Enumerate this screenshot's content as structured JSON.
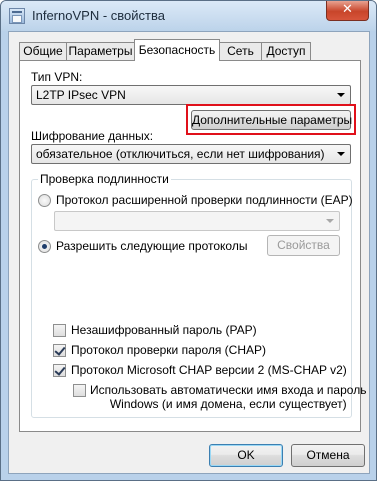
{
  "window": {
    "title": "InfernoVPN - свойства",
    "close_glyph": "✕"
  },
  "tabs": [
    {
      "label": "Общие",
      "active": false
    },
    {
      "label": "Параметры",
      "active": false
    },
    {
      "label": "Безопасность",
      "active": true
    },
    {
      "label": "Сеть",
      "active": false
    },
    {
      "label": "Доступ",
      "active": false
    }
  ],
  "security": {
    "vpn_type_label": "Тип VPN:",
    "vpn_type_value": "L2TP IPsec VPN",
    "advanced_button": "Дополнительные параметры",
    "encryption_label": "Шифрование данных:",
    "encryption_value": "обязательное (отключиться, если нет шифрования)",
    "auth_group_title": "Проверка подлинности",
    "eap_option": "Протокол расширенной проверки подлинности (EAP)",
    "eap_selected": false,
    "eap_combo_value": "",
    "allow_protocols_option": "Разрешить следующие протоколы",
    "allow_protocols_selected": true,
    "properties_button": "Свойства",
    "protocols": [
      {
        "label": "Незашифрованный пароль (PAP)",
        "checked": false
      },
      {
        "label": "Протокол проверки пароля (CHAP)",
        "checked": true
      },
      {
        "label": "Протокол Microsoft CHAP версии 2 (MS-CHAP v2)",
        "checked": true
      }
    ],
    "auto_logon_line1": "Использовать автоматически имя входа и пароль",
    "auto_logon_line2": "Windows (и имя домена, если существует)",
    "auto_logon_checked": false
  },
  "footer": {
    "ok_button": "OK",
    "cancel_button": "Отмена"
  },
  "colors": {
    "highlight": "#e0101a",
    "close_button": "#c8452a"
  }
}
